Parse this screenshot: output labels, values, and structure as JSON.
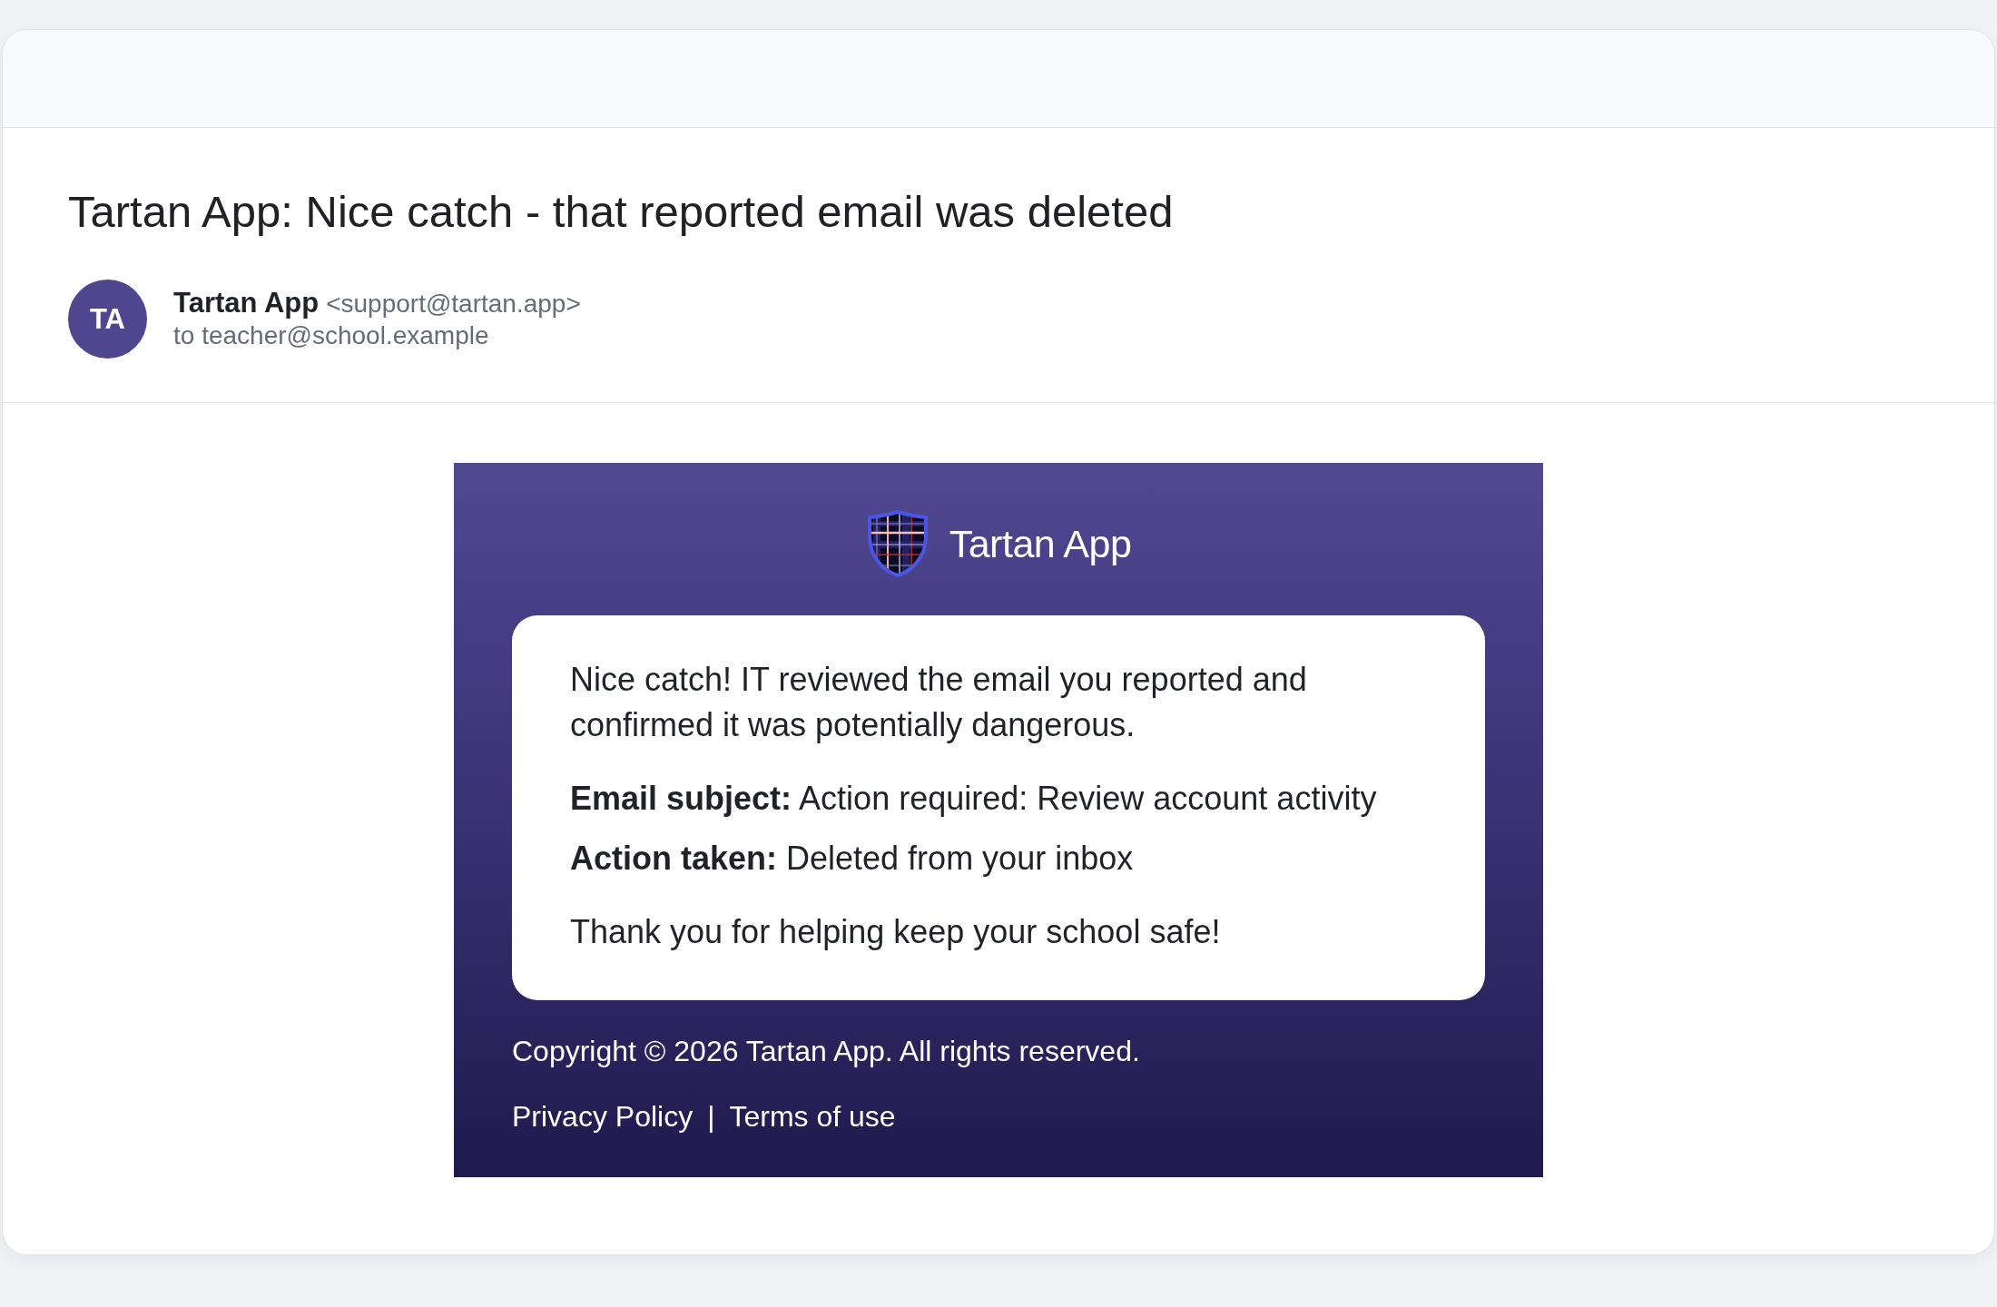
{
  "email": {
    "subject": "Tartan App: Nice catch - that reported email was deleted",
    "sender": {
      "initials": "TA",
      "name": "Tartan App",
      "address": "<support@tartan.app>"
    },
    "recipient": "to teacher@school.example",
    "body": {
      "brand": "Tartan App",
      "message": {
        "intro": "Nice catch! IT reviewed the email you reported and confirmed it was potentially dangerous.",
        "details": [
          "**Email subject:** Action required: Review account activity",
          "**Action taken:** Deleted from your inbox"
        ],
        "closing": "Thank you for helping keep your school safe!"
      },
      "footer": {
        "copyright": "Copyright © 2026 Tartan App. All rights reserved.",
        "links": [
          "Privacy Policy",
          "Terms of use"
        ],
        "separator": "|"
      }
    }
  }
}
